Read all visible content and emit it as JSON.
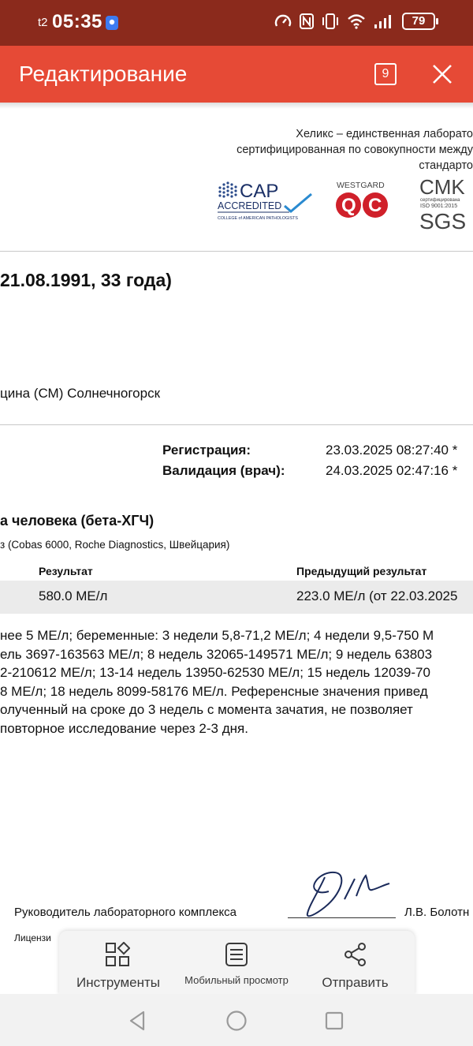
{
  "status_bar": {
    "carrier": "t2",
    "time": "05:35",
    "battery": "79",
    "icons": [
      "location-pin-icon",
      "speedometer-icon",
      "nfc-icon",
      "vibrate-icon",
      "wifi-icon",
      "signal-icon",
      "battery-icon"
    ]
  },
  "appbar": {
    "title": "Редактирование",
    "page_badge": "9",
    "color": "#e64a36"
  },
  "lab_header": {
    "lines": [
      "Хеликс  – единственная лаборато",
      "сертифицированная по совокупности между",
      "стандарто"
    ],
    "logos": {
      "cap": {
        "line1": "CAP",
        "line2": "ACCREDITED",
        "line3": "COLLEGE of AMERICAN PATHOLOGISTS"
      },
      "westgard": {
        "line1": "WESTGARD",
        "line2": "QC"
      },
      "cmk": {
        "line1": "CMK",
        "line2": "сертифицирована",
        "line3": "ISO 9001:2015",
        "line4": "SGS"
      }
    }
  },
  "patient": {
    "dob_line": "21.08.1991, 33 года)",
    "clinic": "цина (СМ) Солнечногорск"
  },
  "dates": {
    "registration_label": "Регистрация:",
    "registration_value": "23.03.2025 08:27:40 *",
    "validation_label": "Валидация (врач):",
    "validation_value": "24.03.2025 02:47:16 *"
  },
  "test": {
    "name": "а человека (бета-ХГЧ)",
    "method": "з (Cobas 6000, Roche Diagnostics, Швейцария)",
    "col_result": "Результат",
    "col_previous": "Предыдущий результат",
    "result": "580.0 МЕ/л",
    "previous": "223.0 МЕ/л (от 22.03.2025"
  },
  "reference": [
    "нее 5 МЕ/л; беременные: 3 недели 5,8-71,2 МЕ/л; 4 недели 9,5-750 М",
    "ель 3697-163563 МЕ/л; 8 недель 32065-149571 МЕ/л; 9 недель 63803",
    "2-210612 МЕ/л; 13-14 недель 13950-62530 МЕ/л; 15 недель 12039-70",
    "8 МЕ/л; 18 недель 8099-58176 МЕ/л. Референсные значения привед",
    "олученный на сроке до 3 недель с момента зачатия, не позволяет",
    " повторное исследование через 2-3 дня."
  ],
  "signature": {
    "label": "Руководитель лабораторного комплекса",
    "name": "Л.В. Болотн",
    "license": "Лицензи"
  },
  "toolbar": {
    "tools_label": "Инструменты",
    "mobile_view_label": "Мобильный просмотр",
    "share_label": "Отправить"
  }
}
